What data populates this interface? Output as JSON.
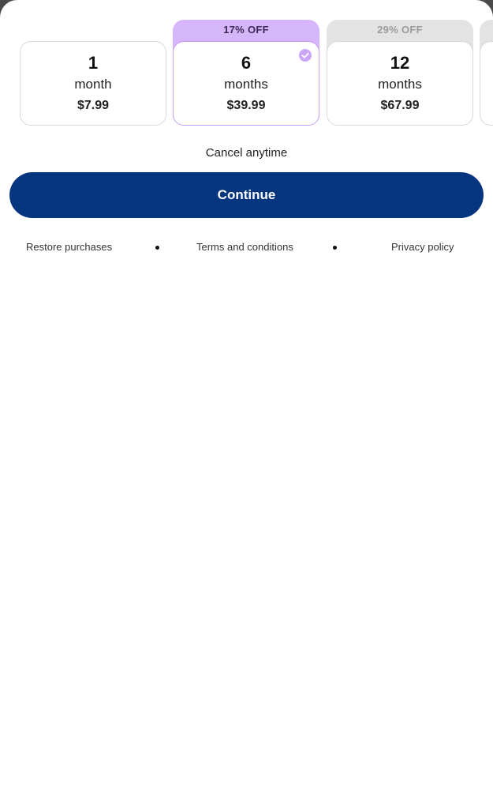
{
  "plans": [
    {
      "qty": "1",
      "unit": "month",
      "price": "$7.99",
      "badge": "",
      "selected": false
    },
    {
      "qty": "6",
      "unit": "months",
      "price": "$39.99",
      "badge": "17% OFF",
      "selected": true
    },
    {
      "qty": "12",
      "unit": "months",
      "price": "$67.99",
      "badge": "29% OFF",
      "selected": false
    }
  ],
  "cancel_note": "Cancel anytime",
  "continue_label": "Continue",
  "footer": {
    "restore": "Restore purchases",
    "terms": "Terms and conditions",
    "privacy": "Privacy policy"
  },
  "colors": {
    "accent": "#063580",
    "selected_badge": "#d6b6fb",
    "selected_border": "#c79cf5",
    "muted_badge": "#e3e3e3"
  }
}
